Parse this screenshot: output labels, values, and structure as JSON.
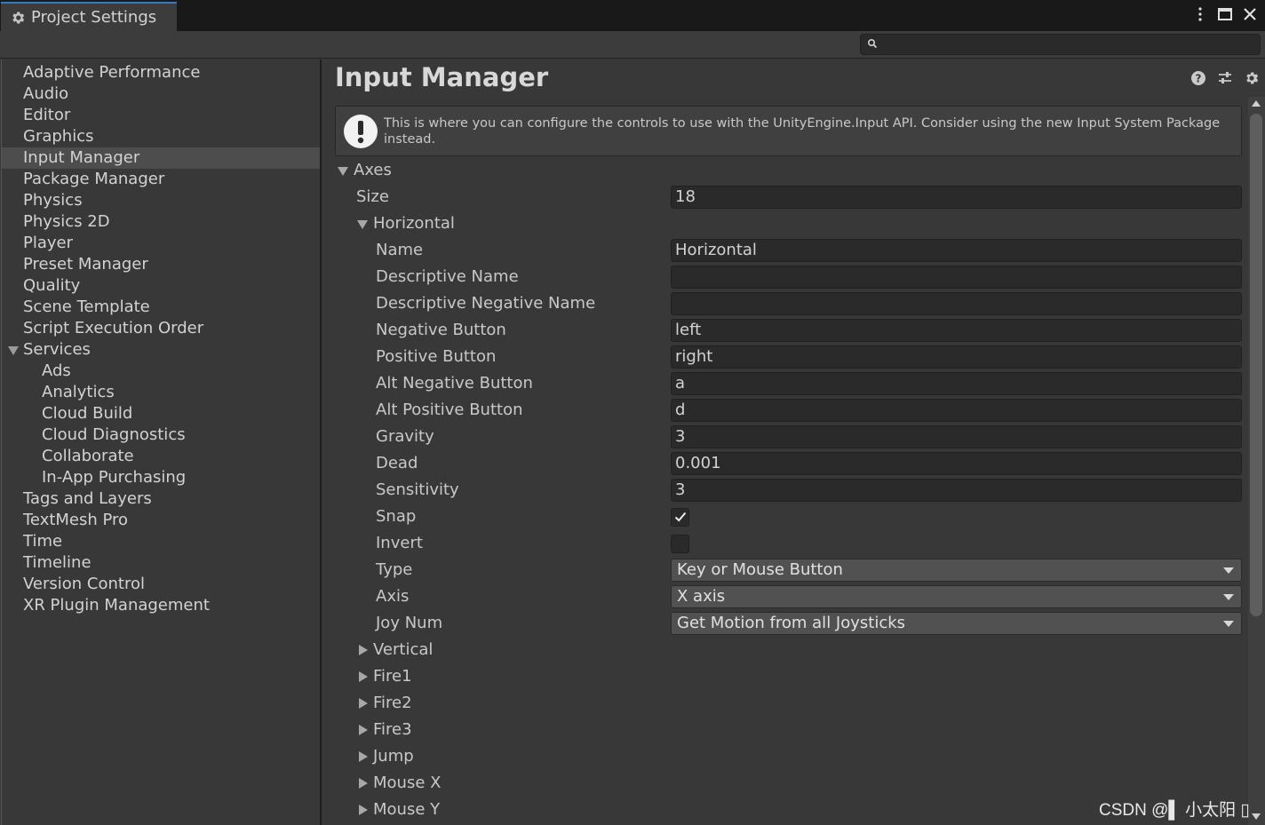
{
  "window": {
    "tab_title": "Project Settings",
    "search": {
      "value": "",
      "placeholder": ""
    }
  },
  "sidebar": {
    "items": [
      {
        "label": "Adaptive Performance",
        "level": 0,
        "selected": false
      },
      {
        "label": "Audio",
        "level": 0,
        "selected": false
      },
      {
        "label": "Editor",
        "level": 0,
        "selected": false
      },
      {
        "label": "Graphics",
        "level": 0,
        "selected": false
      },
      {
        "label": "Input Manager",
        "level": 0,
        "selected": true
      },
      {
        "label": "Package Manager",
        "level": 0,
        "selected": false
      },
      {
        "label": "Physics",
        "level": 0,
        "selected": false
      },
      {
        "label": "Physics 2D",
        "level": 0,
        "selected": false
      },
      {
        "label": "Player",
        "level": 0,
        "selected": false
      },
      {
        "label": "Preset Manager",
        "level": 0,
        "selected": false
      },
      {
        "label": "Quality",
        "level": 0,
        "selected": false
      },
      {
        "label": "Scene Template",
        "level": 0,
        "selected": false
      },
      {
        "label": "Script Execution Order",
        "level": 0,
        "selected": false
      },
      {
        "label": "Services",
        "level": 0,
        "selected": false,
        "expanded": true
      },
      {
        "label": "Ads",
        "level": 1,
        "selected": false
      },
      {
        "label": "Analytics",
        "level": 1,
        "selected": false
      },
      {
        "label": "Cloud Build",
        "level": 1,
        "selected": false
      },
      {
        "label": "Cloud Diagnostics",
        "level": 1,
        "selected": false
      },
      {
        "label": "Collaborate",
        "level": 1,
        "selected": false
      },
      {
        "label": "In-App Purchasing",
        "level": 1,
        "selected": false
      },
      {
        "label": "Tags and Layers",
        "level": 0,
        "selected": false
      },
      {
        "label": "TextMesh Pro",
        "level": 0,
        "selected": false
      },
      {
        "label": "Time",
        "level": 0,
        "selected": false
      },
      {
        "label": "Timeline",
        "level": 0,
        "selected": false
      },
      {
        "label": "Version Control",
        "level": 0,
        "selected": false
      },
      {
        "label": "XR Plugin Management",
        "level": 0,
        "selected": false
      }
    ]
  },
  "main": {
    "title": "Input Manager",
    "help_text": "This is where you can configure the controls to use with the UnityEngine.Input API. Consider using the new Input System Package instead.",
    "axes": {
      "label": "Axes",
      "size_label": "Size",
      "size_value": "18",
      "expanded_axis": {
        "label": "Horizontal",
        "properties": {
          "name_label": "Name",
          "name_value": "Horizontal",
          "desc_name_label": "Descriptive Name",
          "desc_name_value": "",
          "desc_neg_name_label": "Descriptive Negative Name",
          "desc_neg_name_value": "",
          "neg_button_label": "Negative Button",
          "neg_button_value": "left",
          "pos_button_label": "Positive Button",
          "pos_button_value": "right",
          "alt_neg_button_label": "Alt Negative Button",
          "alt_neg_button_value": "a",
          "alt_pos_button_label": "Alt Positive Button",
          "alt_pos_button_value": "d",
          "gravity_label": "Gravity",
          "gravity_value": "3",
          "dead_label": "Dead",
          "dead_value": "0.001",
          "sensitivity_label": "Sensitivity",
          "sensitivity_value": "3",
          "snap_label": "Snap",
          "snap_checked": true,
          "invert_label": "Invert",
          "invert_checked": false,
          "type_label": "Type",
          "type_value": "Key or Mouse Button",
          "axis_label": "Axis",
          "axis_value": "X axis",
          "joy_num_label": "Joy Num",
          "joy_num_value": "Get Motion from all Joysticks"
        }
      },
      "collapsed_axes": [
        "Vertical",
        "Fire1",
        "Fire2",
        "Fire3",
        "Jump",
        "Mouse X",
        "Mouse Y"
      ]
    }
  },
  "watermark": "CSDN @▌ 小太阳 ▯",
  "colors": {
    "background": "#383838",
    "titlebar": "#191919",
    "selection": "#4d4d4d",
    "field": "#2a2a2a",
    "dropdown": "#515151",
    "tab_accent": "#3a79bb"
  }
}
